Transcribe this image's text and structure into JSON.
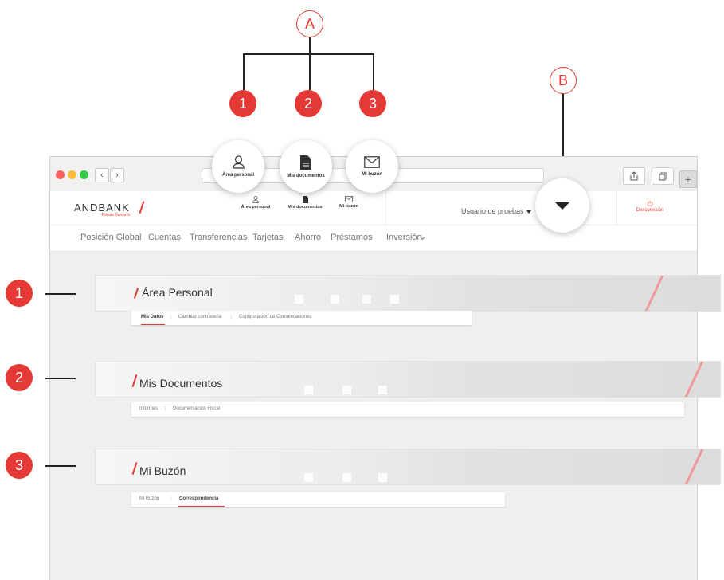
{
  "callouts": {
    "a": "A",
    "b": "B",
    "n1": "1",
    "n2": "2",
    "n3": "3"
  },
  "bubbles": [
    {
      "label": "Área personal",
      "icon": "user-icon"
    },
    {
      "label": "Mis documentos",
      "icon": "document-icon"
    },
    {
      "label": "Mi buzón",
      "icon": "mail-icon"
    }
  ],
  "header": {
    "logo": "ANDBANK",
    "logo_sub": "Private Bankers",
    "items": [
      {
        "label": "Área personal",
        "icon": "user-icon"
      },
      {
        "label": "Mis documentos",
        "icon": "document-icon"
      },
      {
        "label": "Mi buzón",
        "icon": "mail-icon"
      }
    ],
    "user": "Usuario de pruebas",
    "logout": "Desconexión"
  },
  "menu": [
    "Posición Global",
    "Cuentas",
    "Transferencias",
    "Tarjetas",
    "Ahorro",
    "Préstamos",
    "Inversión"
  ],
  "sections": [
    {
      "title": "Área Personal",
      "tabs": [
        "Mis Datos",
        "Cambiar contraseña",
        "Configuración de Comunicaciones"
      ],
      "active": 0
    },
    {
      "title": "Mis Documentos",
      "tabs": [
        "Informes",
        "Documentación Fiscal"
      ],
      "active": -1
    },
    {
      "title": "Mi Buzón",
      "tabs": [
        "Mi Buzón",
        "Correspondencia"
      ],
      "active": 1
    }
  ],
  "colors": {
    "accent": "#e53935"
  }
}
